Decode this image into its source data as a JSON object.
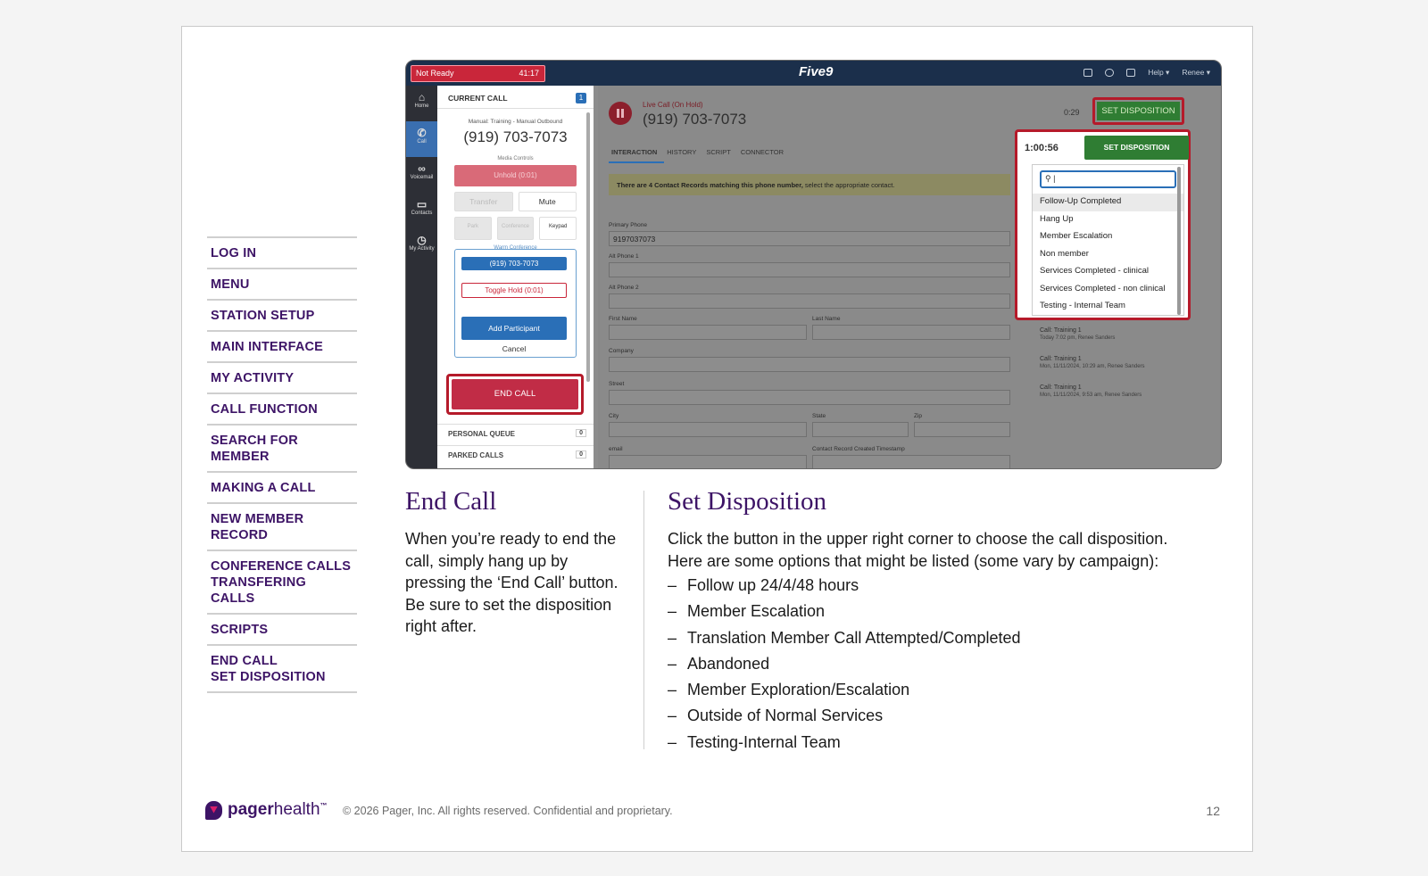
{
  "nav": {
    "items": [
      {
        "lines": [
          "LOG IN"
        ]
      },
      {
        "lines": [
          "MENU"
        ]
      },
      {
        "lines": [
          "STATION SETUP"
        ]
      },
      {
        "lines": [
          "MAIN INTERFACE"
        ]
      },
      {
        "lines": [
          "MY ACTIVITY"
        ]
      },
      {
        "lines": [
          "CALL FUNCTION"
        ]
      },
      {
        "lines": [
          "SEARCH FOR MEMBER"
        ]
      },
      {
        "lines": [
          "MAKING A CALL"
        ]
      },
      {
        "lines": [
          "NEW MEMBER RECORD"
        ]
      },
      {
        "lines": [
          "CONFERENCE CALLS",
          "TRANSFERING CALLS"
        ]
      },
      {
        "lines": [
          "SCRIPTS"
        ]
      },
      {
        "lines": [
          "END CALL",
          "SET DISPOSITION"
        ]
      }
    ]
  },
  "screenshot": {
    "status": "Not Ready",
    "status_timer": "41:17",
    "logo": "Five9",
    "top_right": {
      "help": "Help ▾",
      "user": "Renee ▾"
    },
    "side_items": [
      "Home",
      "Call",
      "Voicemail",
      "Contacts",
      "My Activity"
    ],
    "call_panel": {
      "header": "CURRENT CALL",
      "badge": "1",
      "manual_line": "Manual: Training - Manual Outbound",
      "number": "(919) 703-7073",
      "media_controls": "Media Controls",
      "unhold": "Unhold (0:01)",
      "transfer": "Transfer",
      "mute": "Mute",
      "park": "Park",
      "conference": "Conference",
      "keypad": "Keypad",
      "warm_conference": "Warm Conference",
      "warm_number": "(919) 703-7073",
      "toggle_hold": "Toggle Hold (0:01)",
      "add_participant": "Add Participant",
      "cancel": "Cancel",
      "end_call": "END CALL",
      "personal_queue": "PERSONAL QUEUE",
      "personal_queue_count": "0",
      "parked_calls": "PARKED CALLS",
      "parked_calls_count": "0"
    },
    "main": {
      "live": "Live Call (On Hold)",
      "number": "(919) 703-7073",
      "timer": "0:29",
      "set_disposition": "SET DISPOSITION",
      "tabs": [
        "INTERACTION",
        "HISTORY",
        "SCRIPT",
        "CONNECTOR"
      ],
      "notice_bold": "There are 4 Contact Records matching this phone number,",
      "notice_rest": " select the appropriate contact.",
      "labels": {
        "primary_phone": "Primary Phone",
        "alt1": "Alt Phone 1",
        "alt2": "Alt Phone 2",
        "first": "First Name",
        "last": "Last Name",
        "company": "Company",
        "street": "Street",
        "city": "City",
        "state": "State",
        "zip": "Zip",
        "email": "email",
        "created": "Contact Record Created Timestamp"
      },
      "primary_phone_value": "9197037073",
      "dropdown": {
        "timer": "1:00:56",
        "button": "SET DISPOSITION",
        "search_value": "|",
        "options": [
          "Follow-Up Completed",
          "Hang Up",
          "Member Escalation",
          "Non member",
          "Services Completed - clinical",
          "Services Completed - non clinical",
          "Testing - Internal Team"
        ]
      },
      "recent": [
        {
          "title": "Call: Training 1",
          "meta": "Today 7:02 pm, Renee Sanders"
        },
        {
          "title": "Call: Training 1",
          "meta": "Mon, 11/11/2024, 10:29 am, Renee Sanders"
        },
        {
          "title": "Call: Training 1",
          "meta": "Mon, 11/11/2024, 9:53 am, Renee Sanders"
        }
      ]
    }
  },
  "end_call": {
    "title": "End Call",
    "lines": [
      "When you’re ready to end the",
      "call, simply hang up by",
      "pressing the ‘End Call’ button.",
      "Be sure to set the disposition",
      "right after."
    ]
  },
  "set_disposition": {
    "title": "Set Disposition",
    "lines": [
      "Click the button in the upper right corner to choose the call disposition.",
      "Here are some options that might be listed (some vary by campaign):"
    ],
    "options": [
      "Follow up 24/4/48 hours",
      "Member Escalation",
      "Translation Member Call Attempted/Completed",
      "Abandoned",
      "Member Exploration/Escalation",
      "Outside of Normal Services",
      "Testing-Internal Team"
    ]
  },
  "footer": {
    "brand_bold": "pager",
    "brand_light": "health",
    "tm": "™",
    "copyright": "© 2026 Pager, Inc. All rights reserved. Confidential and proprietary.",
    "page_number": "12"
  }
}
